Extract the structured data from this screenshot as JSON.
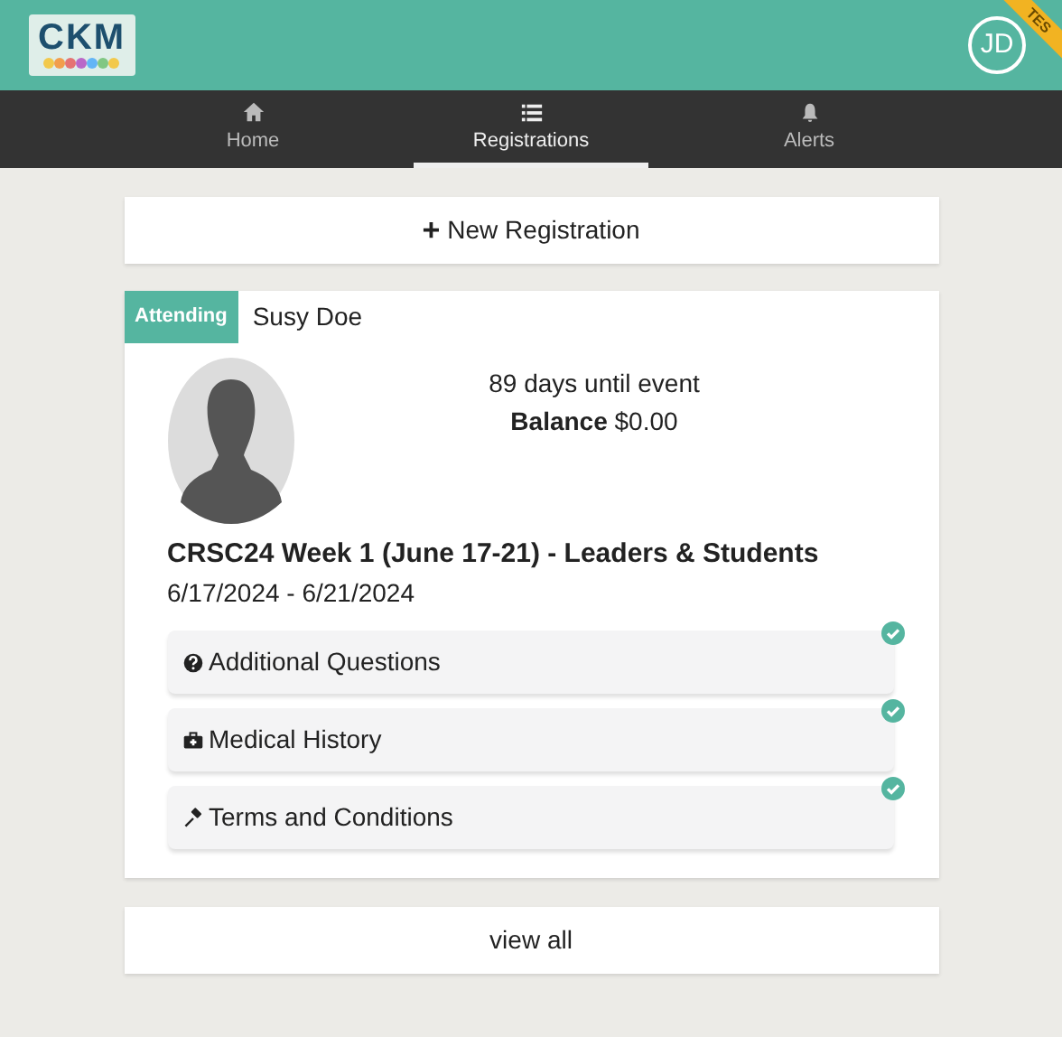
{
  "header": {
    "logo": "CKM",
    "avatar": "JD",
    "ribbon": "TES"
  },
  "nav": [
    {
      "label": "Home",
      "kind": "home",
      "selected": false
    },
    {
      "label": "Registrations",
      "kind": "list",
      "selected": true
    },
    {
      "label": "Alerts",
      "kind": "bell",
      "selected": false
    }
  ],
  "new_button": {
    "icon": "+",
    "label": "New Registration"
  },
  "registration": {
    "status": "Attending",
    "name": "Susy Doe",
    "countdown": "89 days until event",
    "balance": "**Balance** $0.00",
    "event": "CRSC24 Week 1 (June 17-21) - Leaders & Students",
    "dates": "6/17/2024 - 6/21/2024",
    "tasks": [
      {
        "label": "Additional Questions",
        "kind": "question",
        "completed": true
      },
      {
        "label": "Medical History",
        "kind": "medkit",
        "completed": true
      },
      {
        "label": "Terms and Conditions",
        "kind": "gavel",
        "completed": true
      }
    ]
  },
  "view_all": "view all"
}
